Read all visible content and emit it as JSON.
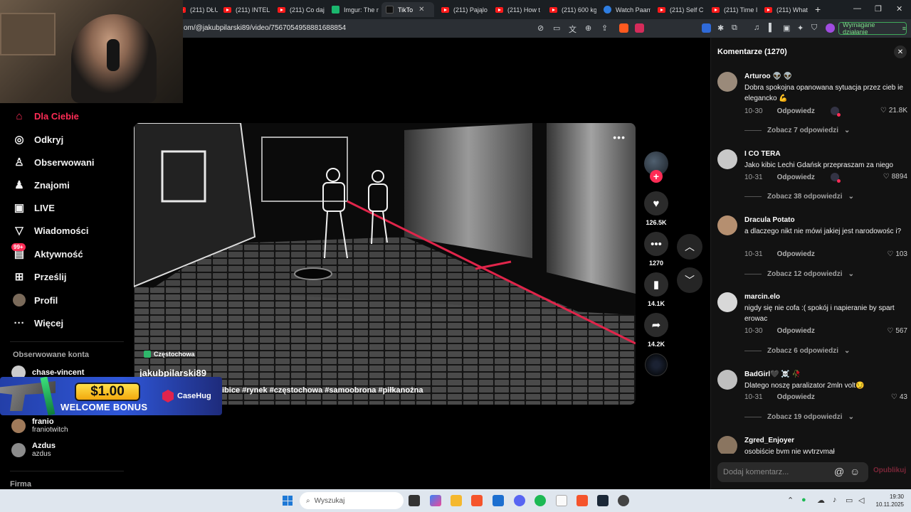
{
  "browser": {
    "tabs": [
      {
        "label": "(211) DŁUŻI",
        "icon": "youtube-icon",
        "active": false
      },
      {
        "label": "(211) INTEL",
        "icon": "youtube-icon",
        "active": false
      },
      {
        "label": "(211) Co daj",
        "icon": "youtube-icon",
        "active": false
      },
      {
        "label": "Imgur: The m",
        "icon": "imgur-icon",
        "active": false
      },
      {
        "label": "TikTo",
        "icon": "tiktok-icon",
        "active": true
      },
      {
        "label": "(211) Pająlo",
        "icon": "youtube-icon",
        "active": false
      },
      {
        "label": "(211) How t",
        "icon": "youtube-icon",
        "active": false
      },
      {
        "label": "(211) 600 kg",
        "icon": "youtube-icon",
        "active": false
      },
      {
        "label": "Watch Paam",
        "icon": "watch-icon",
        "active": false
      },
      {
        "label": "(211) Self C",
        "icon": "youtube-icon",
        "active": false
      },
      {
        "label": "(211) Time I",
        "icon": "youtube-icon",
        "active": false
      },
      {
        "label": "(211) What",
        "icon": "youtube-icon",
        "active": false
      }
    ],
    "url": "om/@jakubpilarski89/video/7567054958881688854",
    "required_action": "Wymagane działanie",
    "brave_count": "1"
  },
  "sidebar": {
    "items": [
      {
        "label": "Dla Ciebie",
        "icon": "home-icon",
        "glyph": "⌂"
      },
      {
        "label": "Odkryj",
        "icon": "compass-icon",
        "glyph": "◎"
      },
      {
        "label": "Obserwowani",
        "icon": "following-icon",
        "glyph": "♙"
      },
      {
        "label": "Znajomi",
        "icon": "friends-icon",
        "glyph": "♟"
      },
      {
        "label": "LIVE",
        "icon": "live-icon",
        "glyph": "▣"
      },
      {
        "label": "Wiadomości",
        "icon": "messages-icon",
        "glyph": "▽"
      },
      {
        "label": "Aktywność",
        "icon": "activity-icon",
        "glyph": "▤"
      },
      {
        "label": "Prześlij",
        "icon": "upload-icon",
        "glyph": "⊞"
      },
      {
        "label": "Profil",
        "icon": "profile-avatar",
        "glyph": "●"
      },
      {
        "label": "Więcej",
        "icon": "more-icon",
        "glyph": "···"
      }
    ],
    "activity_badge": "99+",
    "followed_title": "Obserwowane konta",
    "followed": [
      {
        "name": "chase-vincent",
        "handle": ""
      },
      {
        "name": "franio",
        "handle": "franiotwitch"
      },
      {
        "name": "Azdus",
        "handle": "azdus"
      }
    ],
    "footer": "Firma"
  },
  "ad": {
    "price": "$1.00",
    "headline": "WELCOME BONUS",
    "brand": "CaseHug"
  },
  "video": {
    "location": "Częstochowa",
    "author": "jakubpilarski89",
    "hashtags": "ibice #rynek  #częstochowa #samoobrona #piłkanożna",
    "likes": "126.5K",
    "comments": "1270",
    "saves": "14.1K",
    "shares": "14.2K"
  },
  "comments": {
    "title": "Komentarze (1270)",
    "reply_label": "Odpowiedz",
    "input_placeholder": "Dodaj komentarz...",
    "post_label": "Opublikuj",
    "items": [
      {
        "user": "Arturoo 👽 👽",
        "text": "Dobra spokojna opanowana sytuacja przez cieb ie elegancko 💪",
        "date": "10-30",
        "likes": "21.8K",
        "creator_liked": true,
        "more": "Zobacz 7 odpowiedzi"
      },
      {
        "user": "I CO TERA",
        "text": "Jako kibic Lechi Gdańsk przepraszam za niego",
        "date": "10-31",
        "likes": "8894",
        "creator_liked": true,
        "more": "Zobacz 38 odpowiedzi"
      },
      {
        "user": "Dracula Potato",
        "text": "a dlaczego nikt nie mówi jakiej jest narodowośc i?",
        "date": "10-31",
        "likes": "103",
        "creator_liked": false,
        "more": "Zobacz 12 odpowiedzi"
      },
      {
        "user": "marcin.elo",
        "text": "nigdy się nie cofa :( spokój i napieranie by spart erowac",
        "date": "10-30",
        "likes": "567",
        "creator_liked": false,
        "more": "Zobacz 6 odpowiedzi"
      },
      {
        "user": "BadGirl🖤 ☠️ 🥀",
        "text": "Dlatego noszę paralizator 2mln volt😏",
        "date": "10-31",
        "likes": "43",
        "creator_liked": false,
        "more": "Zobacz 19 odpowiedzi"
      },
      {
        "user": "Zgred_Enjoyer",
        "text": "osobiście bym nie wytrzymał",
        "date": "",
        "likes": "",
        "creator_liked": false,
        "more": ""
      }
    ]
  },
  "taskbar": {
    "search_placeholder": "Wyszukaj",
    "time": "19:30",
    "date": "10.11.2025"
  },
  "colors": {
    "accent": "#fe2c55",
    "panel": "#121212",
    "browser_chrome": "#2b2f34"
  }
}
